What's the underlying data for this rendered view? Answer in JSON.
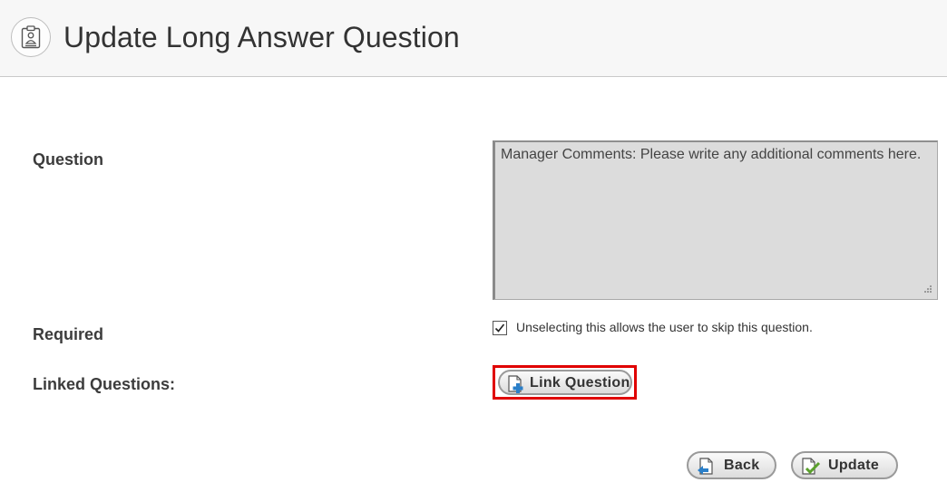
{
  "header": {
    "title": "Update Long Answer Question",
    "icon": "clipboard-badge-icon"
  },
  "form": {
    "question_label": "Question",
    "question_value": "Manager Comments: Please write any additional comments here.",
    "required_label": "Required",
    "required_checked": true,
    "required_hint": "Unselecting this allows the user to skip this question.",
    "linked_label": "Linked Questions:",
    "link_button_label": "Link Question"
  },
  "actions": {
    "back_label": "Back",
    "update_label": "Update"
  },
  "colors": {
    "highlight": "#e00000",
    "textarea_bg": "#dcdcdc"
  }
}
